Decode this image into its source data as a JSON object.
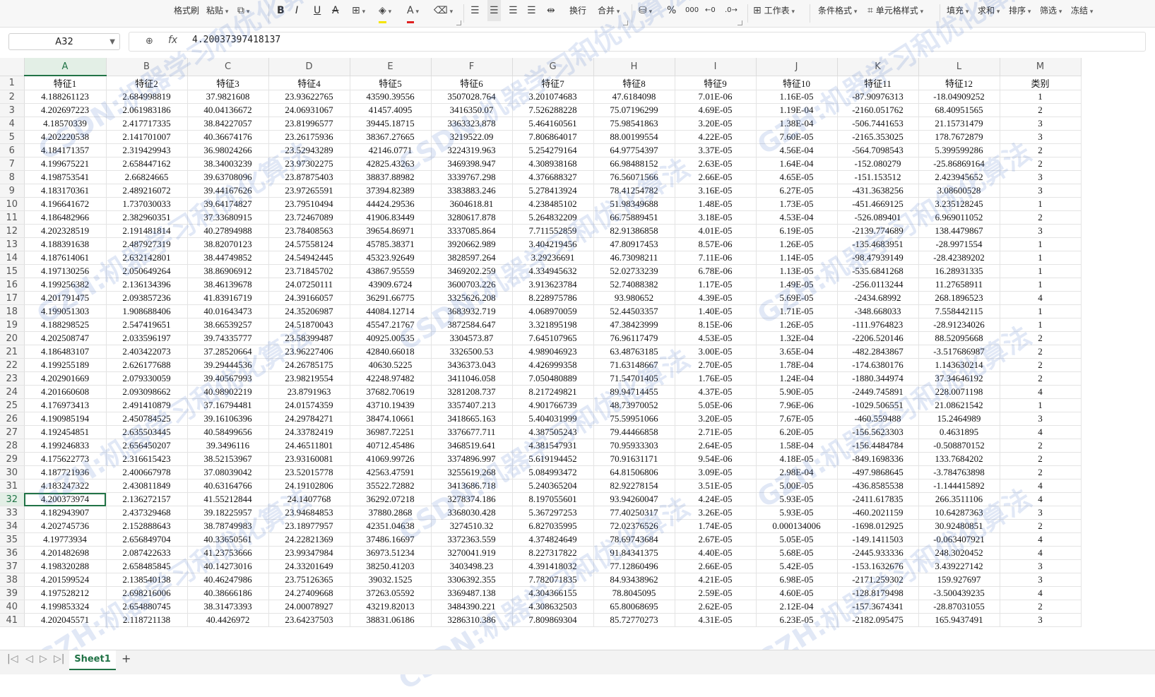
{
  "toolbar": {
    "format_painter": "格式刷",
    "paste": "粘贴",
    "wrap": "换行",
    "merge": "合并",
    "percent": "%",
    "worksheet": "工作表",
    "cond_format": "条件格式",
    "cell_style": "单元格样式",
    "fill": "填充",
    "sum": "求和",
    "sort": "排序",
    "filter": "筛选",
    "freeze": "冻结"
  },
  "formula": {
    "cell_ref": "A32",
    "fx": "fx",
    "value": "4.20037397418137"
  },
  "sheet": {
    "columns": [
      "A",
      "B",
      "C",
      "D",
      "E",
      "F",
      "G",
      "H",
      "I",
      "J",
      "K",
      "L",
      "M"
    ],
    "selected_col": "A",
    "selected_row": 32,
    "headers": [
      "特征1",
      "特征2",
      "特征3",
      "特征4",
      "特征5",
      "特征6",
      "特征7",
      "特征8",
      "特征9",
      "特征10",
      "特征11",
      "特征12",
      "类别"
    ],
    "rows": [
      [
        "4.188261123",
        "2.684998819",
        "37.9821608",
        "23.93622765",
        "43590.39556",
        "3507028.764",
        "3.201074683",
        "47.6184098",
        "7.01E-06",
        "1.16E-05",
        "-87.90976313",
        "-18.04909252",
        "1"
      ],
      [
        "4.202697223",
        "2.061983186",
        "40.04136672",
        "24.06931067",
        "41457.4095",
        "3416350.07",
        "7.526288228",
        "75.07196299",
        "4.69E-05",
        "1.19E-04",
        "-2160.051762",
        "68.40951565",
        "2"
      ],
      [
        "4.18570339",
        "2.417717335",
        "38.84227057",
        "23.81996577",
        "39445.18715",
        "3363323.878",
        "5.464160561",
        "75.98541863",
        "3.20E-05",
        "1.38E-04",
        "-506.7441653",
        "21.15731479",
        "3"
      ],
      [
        "4.202220538",
        "2.141701007",
        "40.36674176",
        "23.26175936",
        "38367.27665",
        "3219522.09",
        "7.806864017",
        "88.00199554",
        "4.22E-05",
        "7.60E-05",
        "-2165.353025",
        "178.7672879",
        "3"
      ],
      [
        "4.184171357",
        "2.319429943",
        "36.98024266",
        "23.52943289",
        "42146.0771",
        "3224319.963",
        "5.254279164",
        "64.97754397",
        "3.37E-05",
        "4.56E-04",
        "-564.7098543",
        "5.399599286",
        "2"
      ],
      [
        "4.199675221",
        "2.658447162",
        "38.34003239",
        "23.97302275",
        "42825.43263",
        "3469398.947",
        "4.308938168",
        "66.98488152",
        "2.63E-05",
        "1.64E-04",
        "-152.080279",
        "-25.86869164",
        "2"
      ],
      [
        "4.198753541",
        "2.66824665",
        "39.63708096",
        "23.87875403",
        "38837.88982",
        "3339767.298",
        "4.376688327",
        "76.56071566",
        "2.66E-05",
        "4.65E-05",
        "-151.153512",
        "2.423945652",
        "3"
      ],
      [
        "4.183170361",
        "2.489216072",
        "39.44167626",
        "23.97265591",
        "37394.82389",
        "3383883.246",
        "5.278413924",
        "78.41254782",
        "3.16E-05",
        "6.27E-05",
        "-431.3638256",
        "3.08600528",
        "3"
      ],
      [
        "4.196641672",
        "1.737030033",
        "39.64174827",
        "23.79510494",
        "44424.29536",
        "3604618.81",
        "4.238485102",
        "51.98349688",
        "1.48E-05",
        "1.73E-05",
        "-451.4669125",
        "3.235128245",
        "1"
      ],
      [
        "4.186482966",
        "2.382960351",
        "37.33680915",
        "23.72467089",
        "41906.83449",
        "3280617.878",
        "5.264832209",
        "66.75889451",
        "3.18E-05",
        "4.53E-04",
        "-526.089401",
        "6.969011052",
        "2"
      ],
      [
        "4.202328519",
        "2.191481814",
        "40.27894988",
        "23.78408563",
        "39654.86971",
        "3337085.864",
        "7.711552859",
        "82.91386858",
        "4.01E-05",
        "6.19E-05",
        "-2139.774689",
        "138.4479867",
        "3"
      ],
      [
        "4.188391638",
        "2.487927319",
        "38.82070123",
        "24.57558124",
        "45785.38371",
        "3920662.989",
        "3.404219456",
        "47.80917453",
        "8.57E-06",
        "1.26E-05",
        "-135.4683951",
        "-28.9971554",
        "1"
      ],
      [
        "4.187614061",
        "2.632142801",
        "38.44749852",
        "24.54942445",
        "45323.92649",
        "3828597.264",
        "3.29236691",
        "46.73098211",
        "7.11E-06",
        "1.14E-05",
        "-98.47939149",
        "-28.42389202",
        "1"
      ],
      [
        "4.197130256",
        "2.050649264",
        "38.86906912",
        "23.71845702",
        "43867.95559",
        "3469202.259",
        "4.334945632",
        "52.02733239",
        "6.78E-06",
        "1.13E-05",
        "-535.6841268",
        "16.28931335",
        "1"
      ],
      [
        "4.199256382",
        "2.136134396",
        "38.46139678",
        "24.07250111",
        "43909.6724",
        "3600703.226",
        "3.913623784",
        "52.74088382",
        "1.17E-05",
        "1.49E-05",
        "-256.0113244",
        "11.27658911",
        "1"
      ],
      [
        "4.201791475",
        "2.093857236",
        "41.83916719",
        "24.39166057",
        "36291.66775",
        "3325626.208",
        "8.228975786",
        "93.980652",
        "4.39E-05",
        "5.69E-05",
        "-2434.68992",
        "268.1896523",
        "4"
      ],
      [
        "4.199051303",
        "1.908688406",
        "40.01643473",
        "24.35206987",
        "44084.12714",
        "3683932.719",
        "4.068970059",
        "52.44503357",
        "1.40E-05",
        "1.71E-05",
        "-348.668033",
        "7.558442115",
        "1"
      ],
      [
        "4.188298525",
        "2.547419651",
        "38.66539257",
        "24.51870043",
        "45547.21767",
        "3872584.647",
        "3.321895198",
        "47.38423999",
        "8.15E-06",
        "1.26E-05",
        "-111.9764823",
        "-28.91234026",
        "1"
      ],
      [
        "4.202508747",
        "2.033596197",
        "39.74335777",
        "23.58399487",
        "40925.00535",
        "3304573.87",
        "7.645107965",
        "76.96117479",
        "4.53E-05",
        "1.32E-04",
        "-2206.520146",
        "88.52095668",
        "2"
      ],
      [
        "4.186483107",
        "2.403422073",
        "37.28520664",
        "23.96227406",
        "42840.66018",
        "3326500.53",
        "4.989046923",
        "63.48763185",
        "3.00E-05",
        "3.65E-04",
        "-482.2843867",
        "-3.517686987",
        "2"
      ],
      [
        "4.199255189",
        "2.626177688",
        "39.29444536",
        "24.26785175",
        "40630.5225",
        "3436373.043",
        "4.426999358",
        "71.63148667",
        "2.70E-05",
        "1.78E-04",
        "-174.6380176",
        "1.143630214",
        "2"
      ],
      [
        "4.202901669",
        "2.079330059",
        "39.40567993",
        "23.98219554",
        "42248.97482",
        "3411046.058",
        "7.050480889",
        "71.54701405",
        "1.76E-05",
        "1.24E-04",
        "-1880.344974",
        "37.34646192",
        "2"
      ],
      [
        "4.201660608",
        "2.093098662",
        "40.98902219",
        "23.8791963",
        "37682.70619",
        "3281208.737",
        "8.217249821",
        "89.94714455",
        "4.37E-05",
        "5.90E-05",
        "-2449.745891",
        "228.0071198",
        "4"
      ],
      [
        "4.176973413",
        "2.491410879",
        "37.16794481",
        "24.01574359",
        "43710.19439",
        "3357407.213",
        "4.901766739",
        "48.73970052",
        "5.05E-06",
        "7.96E-06",
        "-1029.506551",
        "21.08621542",
        "1"
      ],
      [
        "4.190985194",
        "2.450784525",
        "39.16106396",
        "24.29784271",
        "38474.10661",
        "3418665.163",
        "5.404031999",
        "75.59951066",
        "3.20E-05",
        "7.67E-05",
        "-460.559488",
        "15.2464989",
        "3"
      ],
      [
        "4.192454851",
        "2.635503445",
        "40.58499656",
        "24.33782419",
        "36987.72251",
        "3376677.711",
        "4.387505243",
        "79.44466858",
        "2.71E-05",
        "6.20E-05",
        "-156.5623303",
        "0.4631895",
        "4"
      ],
      [
        "4.199246833",
        "2.656450207",
        "39.3496116",
        "24.46511801",
        "40712.45486",
        "3468519.641",
        "4.381547931",
        "70.95933303",
        "2.64E-05",
        "1.58E-04",
        "-156.4484784",
        "-0.508870152",
        "2"
      ],
      [
        "4.175622773",
        "2.316615423",
        "38.52153967",
        "23.93160081",
        "41069.99726",
        "3374896.997",
        "5.619194452",
        "70.91631171",
        "9.54E-06",
        "4.18E-05",
        "-849.1698336",
        "133.7684202",
        "2"
      ],
      [
        "4.187721936",
        "2.400667978",
        "37.08039042",
        "23.52015778",
        "42563.47591",
        "3255619.268",
        "5.084993472",
        "64.81506806",
        "3.09E-05",
        "2.98E-04",
        "-497.9868645",
        "-3.784763898",
        "2"
      ],
      [
        "4.183247322",
        "2.430811849",
        "40.63164766",
        "24.19102806",
        "35522.72882",
        "3413686.718",
        "5.240365204",
        "82.92278154",
        "3.51E-05",
        "5.00E-05",
        "-436.8585538",
        "-1.144415892",
        "4"
      ],
      [
        "4.200373974",
        "2.136272157",
        "41.55212844",
        "24.1407768",
        "36292.07218",
        "3278374.186",
        "8.197055601",
        "93.94260047",
        "4.24E-05",
        "5.93E-05",
        "-2411.617835",
        "266.3511106",
        "4"
      ],
      [
        "4.182943907",
        "2.437329468",
        "39.18225957",
        "23.94684853",
        "37880.2868",
        "3368030.428",
        "5.367297253",
        "77.40250317",
        "3.26E-05",
        "5.93E-05",
        "-460.2021159",
        "10.64287363",
        "3"
      ],
      [
        "4.202745736",
        "2.152888643",
        "38.78749983",
        "23.18977957",
        "42351.04638",
        "3274510.32",
        "6.827035995",
        "72.02376526",
        "1.74E-05",
        "0.000134006",
        "-1698.012925",
        "30.92480851",
        "2"
      ],
      [
        "4.19773934",
        "2.656849704",
        "40.33650561",
        "24.22821369",
        "37486.16697",
        "3372363.559",
        "4.374824649",
        "78.69743684",
        "2.67E-05",
        "5.05E-05",
        "-149.1411503",
        "-0.063407921",
        "4"
      ],
      [
        "4.201482698",
        "2.087422633",
        "41.23753666",
        "23.99347984",
        "36973.51234",
        "3270041.919",
        "8.227317822",
        "91.84341375",
        "4.40E-05",
        "5.68E-05",
        "-2445.933336",
        "248.3020452",
        "4"
      ],
      [
        "4.198320288",
        "2.658485845",
        "40.14273016",
        "24.33201649",
        "38250.41203",
        "3403498.23",
        "4.391418032",
        "77.12860496",
        "2.66E-05",
        "5.42E-05",
        "-153.1632676",
        "3.439227142",
        "3"
      ],
      [
        "4.201599524",
        "2.138540138",
        "40.46247986",
        "23.75126365",
        "39032.1525",
        "3306392.355",
        "7.782071835",
        "84.93438962",
        "4.21E-05",
        "6.98E-05",
        "-2171.259302",
        "159.927697",
        "3"
      ],
      [
        "4.197528212",
        "2.698216006",
        "40.38666186",
        "24.27409668",
        "37263.05592",
        "3369487.138",
        "4.304366155",
        "78.8045095",
        "2.59E-05",
        "4.60E-05",
        "-128.8179498",
        "-3.500439235",
        "4"
      ],
      [
        "4.199853324",
        "2.654880745",
        "38.31473393",
        "24.00078927",
        "43219.82013",
        "3484390.221",
        "4.308632503",
        "65.80068695",
        "2.62E-05",
        "2.12E-04",
        "-157.3674341",
        "-28.87031055",
        "2"
      ],
      [
        "4.202045571",
        "2.118721138",
        "40.4426972",
        "23.64237503",
        "38831.06186",
        "3286310.386",
        "7.809869304",
        "85.72770273",
        "4.31E-05",
        "6.23E-05",
        "-2182.095475",
        "165.9437491",
        "3"
      ]
    ]
  },
  "tabs": {
    "sheet1": "Sheet1",
    "add": "+"
  },
  "watermark": {
    "text1": "CSDN:机器学习和优化算法",
    "text2": "GZH:机器学习和优化算法",
    "color": "#466ec8"
  },
  "colors": {
    "accent": "#217346",
    "header_bg": "#f5f5f5"
  }
}
